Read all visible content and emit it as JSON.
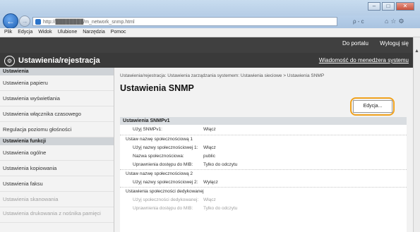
{
  "browser": {
    "url": "http://████████/m_network_snmp.html",
    "search": "ρ - c",
    "menu": [
      "Plik",
      "Edycja",
      "Widok",
      "Ulubione",
      "Narzędzia",
      "Pomoc"
    ]
  },
  "header": {
    "links": [
      "Do portalu",
      "Wyloguj się"
    ],
    "section_title": "Ustawienia/rejestracja",
    "manager_link": "Wiadomość do menedżera systemu"
  },
  "sidebar": {
    "group1": "Ustawienia",
    "items1": [
      "Ustawienia papieru",
      "Ustawienia wyświetlania",
      "Ustawienia włącznika czasowego",
      "Regulacja poziomu głośności"
    ],
    "group2": "Ustawienia funkcji",
    "items2": [
      "Ustawienia ogólne",
      "Ustawienia kopiowania",
      "Ustawienia faksu",
      "Ustawienia skanowania",
      "Ustawienia drukowania z nośnika pamięci"
    ]
  },
  "main": {
    "breadcrumb": "Ustawienia/rejestracja: Ustawienia zarządzania systemem: Ustawienia sieciowe > Ustawienia SNMP",
    "title": "Ustawienia SNMP",
    "edit_label": "Edycja...",
    "section_title": "Ustawienia SNMPv1",
    "use_snmpv1": {
      "key": "Użyj SNMPv1:",
      "value": "Włącz"
    },
    "community1": {
      "title": "Ustaw nazwę społecznościową 1",
      "rows": [
        {
          "key": "Użyj nazwy społecznościowej 1:",
          "value": "Włącz"
        },
        {
          "key": "Nazwa społecznościowa:",
          "value": "public"
        },
        {
          "key": "Uprawnienia dostępu do MIB:",
          "value": "Tylko do odczytu"
        }
      ]
    },
    "community2": {
      "title": "Ustaw nazwę społecznościową 2",
      "rows": [
        {
          "key": "Użyj nazwy społecznościowej 2:",
          "value": "Wyłącz"
        }
      ]
    },
    "dedicated": {
      "title": "Ustawienia społeczności dedykowanej",
      "rows": [
        {
          "key": "Użyj społeczności dedykowanej:",
          "value": "Włącz"
        },
        {
          "key": "Uprawnienia dostępu do MIB:",
          "value": "Tylko do odczytu"
        }
      ]
    }
  }
}
